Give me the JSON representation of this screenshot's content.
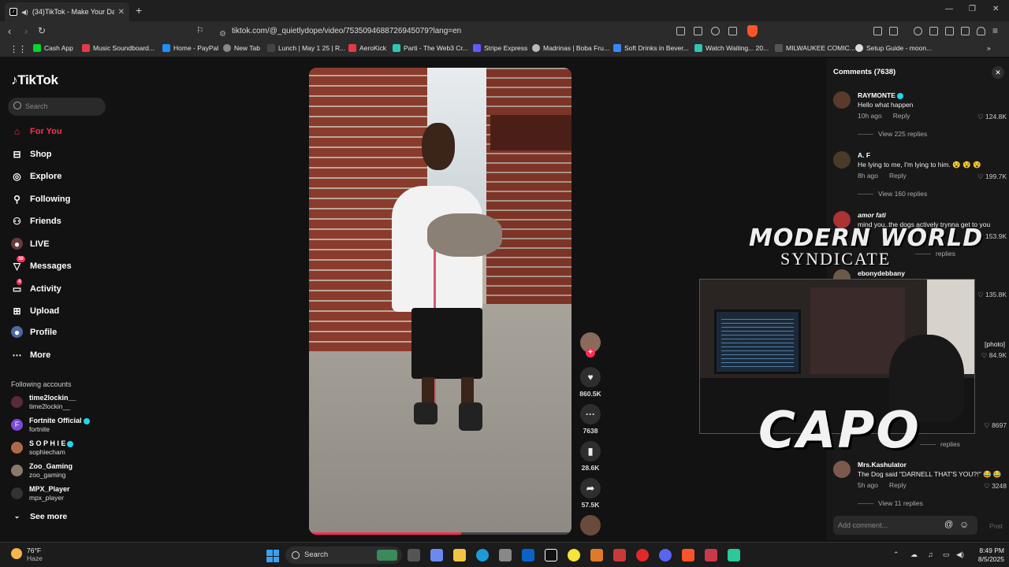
{
  "browser": {
    "tab_title": "(34)TikTok - Make Your Day",
    "url": "tiktok.com/@_quietlydope/video/7535094688726945079?lang=en",
    "bookmarks": [
      {
        "label": "Cash App",
        "color": "#00d632"
      },
      {
        "label": "Music Soundboard...",
        "color": "#e63946"
      },
      {
        "label": "Home - PayPal",
        "color": "#1e90ff"
      },
      {
        "label": "New Tab",
        "color": "#888888"
      },
      {
        "label": "Lunch | May 1 25 | R...",
        "color": "#444444"
      },
      {
        "label": "AeroKick",
        "color": "#e63946"
      },
      {
        "label": "Parti - The Web3 Cr...",
        "color": "#2ec4b6"
      },
      {
        "label": "Stripe Express",
        "color": "#635bff"
      },
      {
        "label": "Madrinas | Boba Fru...",
        "color": "#bbbbbb"
      },
      {
        "label": "Soft Drinks in Bever...",
        "color": "#3a86ff"
      },
      {
        "label": "Watch Waiting... 20...",
        "color": "#2ec4b6"
      },
      {
        "label": "MILWAUKEE COMIC...",
        "color": "#555555"
      },
      {
        "label": "Setup Guide - moon...",
        "color": "#dddddd"
      }
    ]
  },
  "sidebar": {
    "logo": "TikTok",
    "search_placeholder": "Search",
    "nav": [
      {
        "label": "For You",
        "icon": "home-icon",
        "active": true
      },
      {
        "label": "Shop",
        "icon": "shop-icon"
      },
      {
        "label": "Explore",
        "icon": "compass-icon"
      },
      {
        "label": "Following",
        "icon": "following-icon"
      },
      {
        "label": "Friends",
        "icon": "friends-icon"
      },
      {
        "label": "LIVE",
        "icon": "live-icon"
      },
      {
        "label": "Messages",
        "icon": "messages-icon",
        "badge": "30"
      },
      {
        "label": "Activity",
        "icon": "activity-icon",
        "badge": "4"
      },
      {
        "label": "Upload",
        "icon": "upload-icon"
      },
      {
        "label": "Profile",
        "icon": "profile-icon"
      },
      {
        "label": "More",
        "icon": "more-icon"
      }
    ],
    "following_title": "Following accounts",
    "accounts": [
      {
        "name": "time2lockin__",
        "handle": "time2lockin__",
        "color": "#5a2a3a",
        "verified": false
      },
      {
        "name": "Fortnite Official",
        "handle": "fortnite",
        "color": "#7b4bd9",
        "verified": true
      },
      {
        "name": "S O P H I E",
        "handle": "sophiecham",
        "color": "#b06a4a",
        "verified": true
      },
      {
        "name": "Zoo_Gaming",
        "handle": "zoo_gaming",
        "color": "#8a7a6a",
        "verified": false
      },
      {
        "name": "MPX_Player",
        "handle": "mpx_player",
        "color": "#333333",
        "verified": false
      }
    ],
    "see_more": "See more"
  },
  "video_actions": {
    "likes": "860.5K",
    "comments": "7638",
    "saves": "28.6K",
    "shares": "57.5K"
  },
  "comments_panel": {
    "title": "Comments (7638)",
    "comments": [
      {
        "user": "RAYMONTE",
        "text": "Hello what happen",
        "time": "10h ago",
        "likes": "124.8K",
        "view": "View 225 replies",
        "verified": true,
        "color": "#5a3a2a"
      },
      {
        "user": "A. F",
        "text": "He lying to me, I'm lying to him. 😵 😵 😵",
        "time": "8h ago",
        "likes": "199.7K",
        "view": "View 160 replies",
        "verified": false,
        "color": "#4a3a2a"
      },
      {
        "user": "amor fati",
        "text": "mind you..the dogs actively trynna get to you",
        "time": "",
        "likes": "153.9K",
        "view": "replies",
        "verified": false,
        "color": "#a33"
      },
      {
        "user": "ebonydebbany",
        "text": "",
        "time": "",
        "likes": "135.8K",
        "view": "",
        "verified": false,
        "color": "#6a5a4a"
      },
      {
        "user": "",
        "text": "[photo]",
        "time": "",
        "likes": "84.9K",
        "view": "",
        "verified": false,
        "color": "#333"
      },
      {
        "user": "",
        "text": "",
        "time": "",
        "likes": "8697",
        "view": "replies",
        "verified": false,
        "color": "#333"
      },
      {
        "user": "Mrs.Kashulator",
        "text": "The Dog said \"DARNELL THAT'S YOU?!\" 😂 😂",
        "time": "5h ago",
        "likes": "3248",
        "view": "View 11 replies",
        "verified": false,
        "color": "#7a5a4a"
      }
    ],
    "reply_label": "Reply",
    "add_placeholder": "Add comment...",
    "post_label": "Post"
  },
  "overlay": {
    "title": "MODERN WORLD",
    "subtitle": "SYNDICATE",
    "name": "CAPO"
  },
  "taskbar": {
    "temp": "76°F",
    "condition": "Haze",
    "search": "Search",
    "time": "8:49 PM",
    "date": "8/5/2025"
  }
}
